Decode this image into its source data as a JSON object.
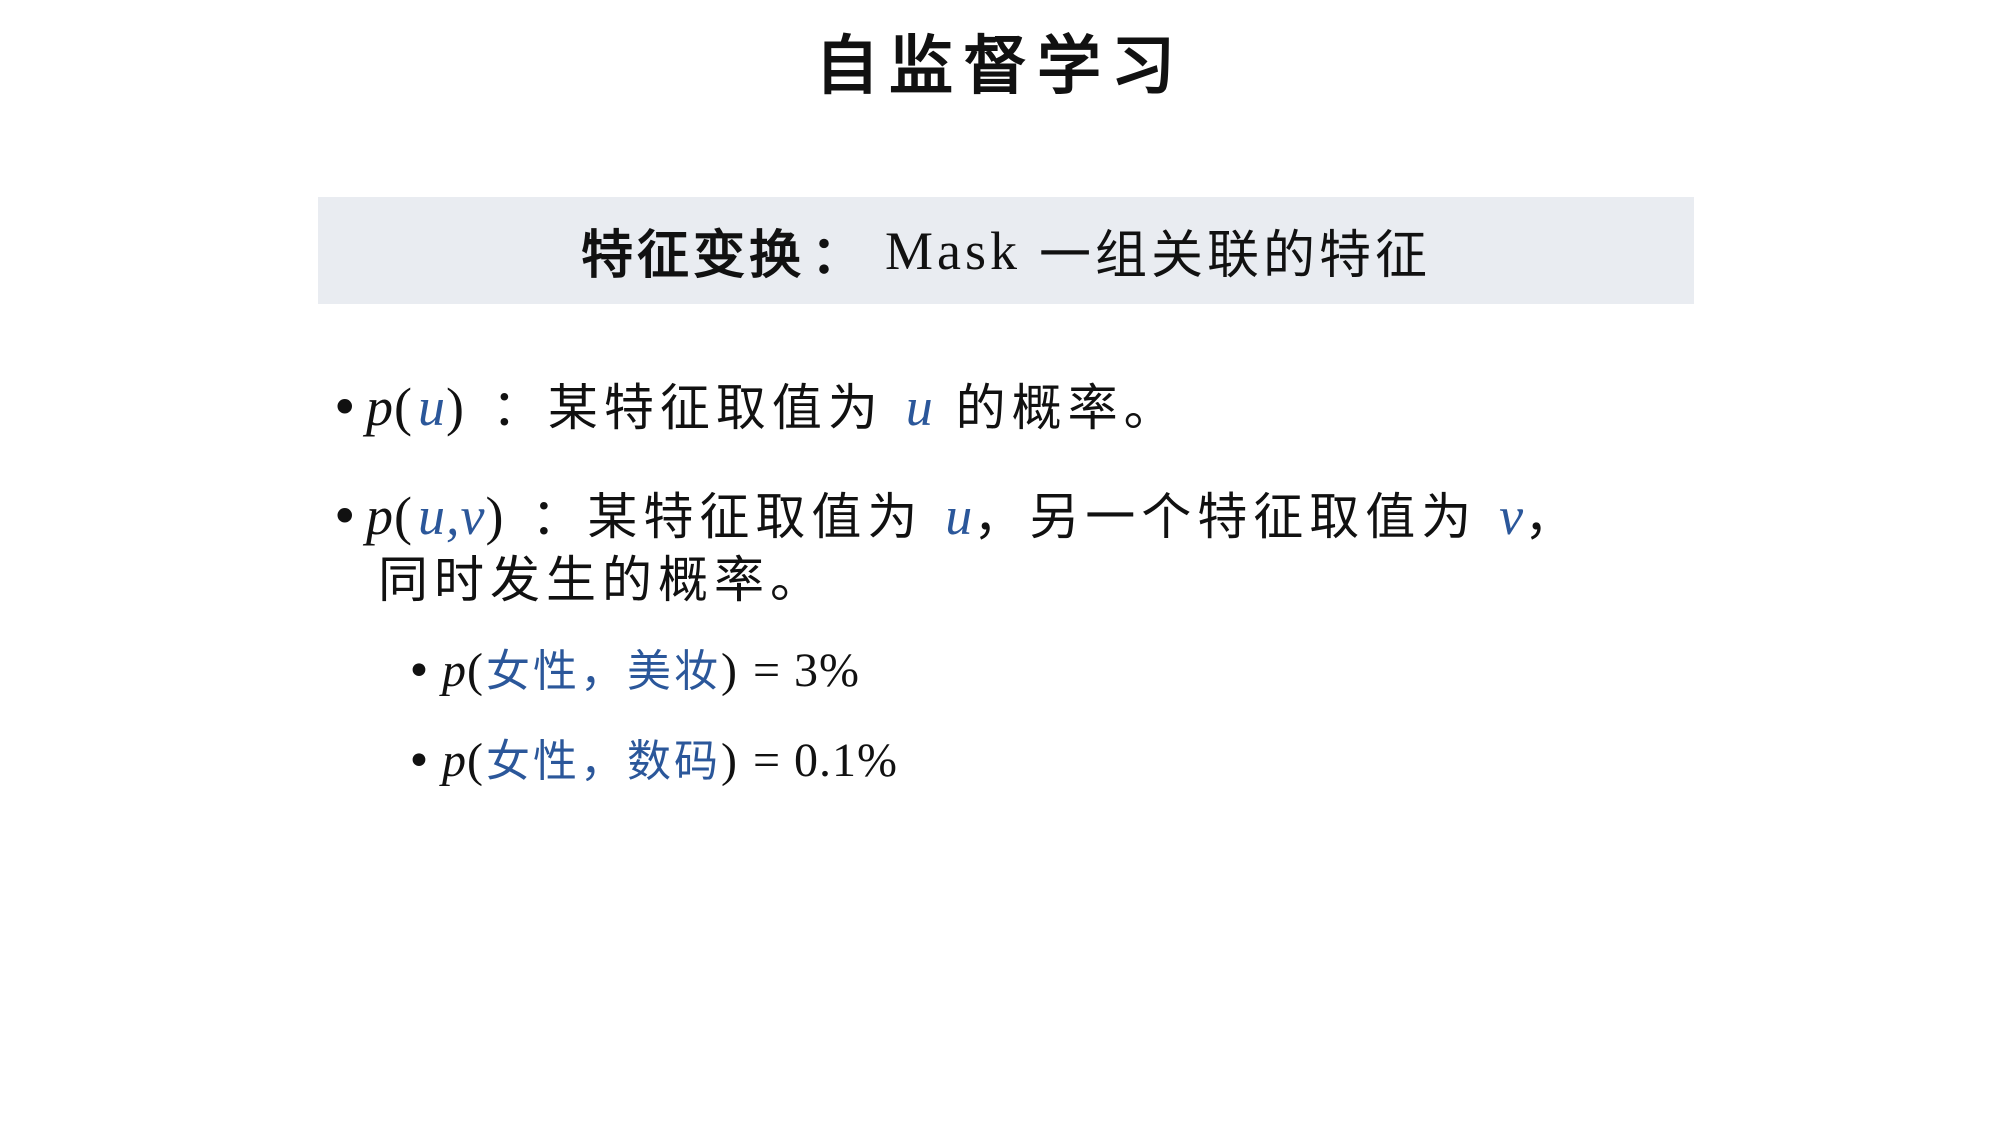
{
  "title": "自监督学习",
  "subtitle": {
    "bold_part": "特征变换",
    "separator": "：",
    "mask_word": "Mask",
    "rest": "一组关联的特征"
  },
  "bullets": [
    {
      "func": "p",
      "open": "(",
      "args": "u",
      "close": ")",
      "desc_before": " ：某特征取值为 ",
      "var1": "u",
      "desc_after": " 的概率。"
    },
    {
      "func": "p",
      "open": "(",
      "args": "u,v",
      "close": ")",
      "desc_before": " ：某特征取值为 ",
      "var1": "u",
      "desc_mid": "，另一个特征取值为 ",
      "var2": "v",
      "desc_end": "，",
      "continuation": "同时发生的概率。"
    }
  ],
  "sub_bullets": [
    {
      "func": "p",
      "open": "(",
      "arg1": "女性",
      "sep": "，",
      "arg2": "美妆",
      "close": ")",
      "equals": " = 3%"
    },
    {
      "func": "p",
      "open": "(",
      "arg1": "女性",
      "sep": "，",
      "arg2": "数码",
      "close": ")",
      "equals": " = 0.1%"
    }
  ],
  "colors": {
    "accent_blue": "#2b579a",
    "box_background": "#e9ecf1",
    "text": "#111111"
  }
}
